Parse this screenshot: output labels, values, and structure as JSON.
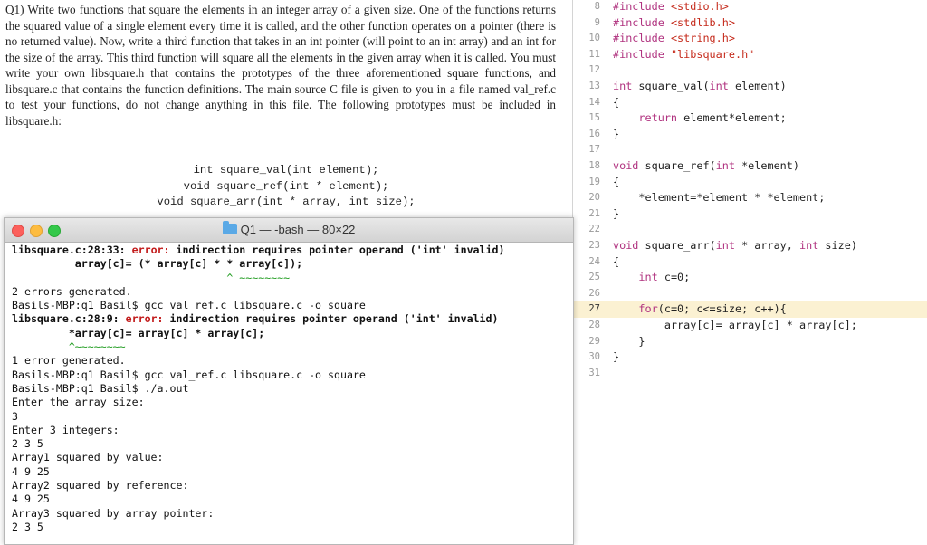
{
  "document": {
    "para": "Q1) Write two functions that square the elements in an integer array of a given size. One of the functions returns the squared value of a single element every time it is called, and the other function operates on a pointer (there is no returned value). Now, write a third function that takes in an int pointer (will point to an int array) and an int for the size of the array. This third function will square all the elements in the given array when it is called. You must write your own libsquare.h that contains the prototypes of the three aforementioned square functions, and libsquare.c that contains the function definitions. The main source C file is given to you in a file named val_ref.c to test your functions, do not change anything in this file. The following prototypes must be included in libsquare.h:",
    "prototypes": [
      "int square_val(int element);",
      "void square_ref(int * element);",
      "void square_arr(int * array, int size);"
    ]
  },
  "editor": {
    "lines": [
      {
        "num": "8",
        "text": "#include <stdio.h>"
      },
      {
        "num": "9",
        "text": "#include <stdlib.h>"
      },
      {
        "num": "10",
        "text": "#include <string.h>"
      },
      {
        "num": "11",
        "text": "#include \"libsquare.h\""
      },
      {
        "num": "12",
        "text": ""
      },
      {
        "num": "13",
        "text": "int square_val(int element)"
      },
      {
        "num": "14",
        "text": "{"
      },
      {
        "num": "15",
        "text": "    return element*element;"
      },
      {
        "num": "16",
        "text": "}"
      },
      {
        "num": "17",
        "text": ""
      },
      {
        "num": "18",
        "text": "void square_ref(int *element)"
      },
      {
        "num": "19",
        "text": "{"
      },
      {
        "num": "20",
        "text": "    *element=*element * *element;"
      },
      {
        "num": "21",
        "text": "}"
      },
      {
        "num": "22",
        "text": ""
      },
      {
        "num": "23",
        "text": "void square_arr(int * array, int size)"
      },
      {
        "num": "24",
        "text": "{"
      },
      {
        "num": "25",
        "text": "    int c=0;"
      },
      {
        "num": "26",
        "text": ""
      },
      {
        "num": "27",
        "text": "    for(c=0; c<=size; c++){"
      },
      {
        "num": "28",
        "text": "        array[c]= array[c] * array[c];"
      },
      {
        "num": "29",
        "text": "    }"
      },
      {
        "num": "30",
        "text": "}"
      },
      {
        "num": "31",
        "text": ""
      }
    ],
    "current_line": "27"
  },
  "terminal": {
    "title": "Q1 — -bash — 80×22",
    "lines": [
      "libsquare.c:28:33: error: indirection requires pointer operand ('int' invalid)",
      "          array[c]= (* array[c] * * array[c]);",
      "                                  ^ ~~~~~~~~",
      "2 errors generated.",
      "Basils-MBP:q1 Basil$ gcc val_ref.c libsquare.c -o square",
      "libsquare.c:28:9: error: indirection requires pointer operand ('int' invalid)",
      "         *array[c]= array[c] * array[c];",
      "         ^~~~~~~~~",
      "1 error generated.",
      "Basils-MBP:q1 Basil$ gcc val_ref.c libsquare.c -o square",
      "Basils-MBP:q1 Basil$ ./a.out",
      "Enter the array size:",
      "3",
      "Enter 3 integers:",
      "2 3 5",
      "Array1 squared by value:",
      "4 9 25",
      "Array2 squared by reference:",
      "4 9 25",
      "Array3 squared by array pointer:",
      "2 3 5"
    ]
  },
  "colors": {
    "keyword": "#b0327f",
    "string": "#c52a1b",
    "error": "#c21a1a",
    "caret": "#1d9b1d",
    "current_line_highlight": "#fbf1d2"
  }
}
